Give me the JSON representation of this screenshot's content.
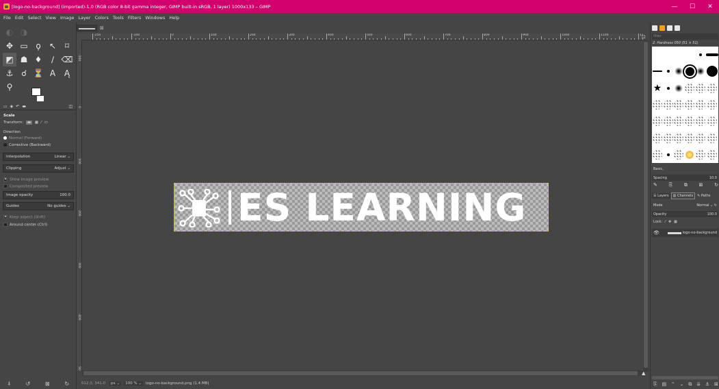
{
  "window": {
    "title": "[logo-no-background] (imported)-1.0 (RGB color 8-bit gamma integer, GIMP built-in sRGB, 1 layer) 1000x133 – GIMP",
    "min": "—",
    "max": "☐",
    "close": "✕"
  },
  "menubar": {
    "items": [
      "File",
      "Edit",
      "Select",
      "View",
      "Image",
      "Layer",
      "Colors",
      "Tools",
      "Filters",
      "Windows",
      "Help"
    ]
  },
  "toolbox": {
    "tool_options": {
      "title": "Scale",
      "transform_label": "Transform:",
      "direction_label": "Direction",
      "direction_options": [
        "Normal (Forward)",
        "Corrective (Backward)"
      ],
      "interpolation": {
        "label": "Interpolation",
        "value": "Linear"
      },
      "clipping": {
        "label": "Clipping",
        "value": "Adjust"
      },
      "show_preview": "Show image preview",
      "composited_preview": "Composited preview",
      "image_opacity": {
        "label": "Image opacity",
        "value": "100.0"
      },
      "guides": {
        "label": "Guides",
        "value": "No guides"
      },
      "keep_aspect": "Keep aspect (Shift)",
      "around_center": "Around center (Ctrl)"
    }
  },
  "rulers": {
    "h_labels": [
      "-250",
      "-100",
      "0",
      "100",
      "200",
      "300",
      "400",
      "500",
      "600",
      "700",
      "800",
      "900",
      "1000",
      "1100",
      "1200"
    ],
    "v_labels": [
      "-100",
      "0",
      "100",
      "200",
      "300",
      "400",
      "500"
    ]
  },
  "canvas": {
    "logo_text": "ES LEARNING"
  },
  "status": {
    "coords": "612.0, 341.0",
    "unit": "px",
    "zoom": "100 %",
    "file": "logo-no-background.png (1.4 MB)"
  },
  "dock": {
    "filter_placeholder": "filter",
    "brush_name": "2. Hardness 050 (51 × 51)",
    "preset_label": "Basic,",
    "spacing": {
      "label": "Spacing",
      "value": "10.0"
    },
    "tabs": [
      "Layers",
      "Channels",
      "Paths"
    ],
    "mode": {
      "label": "Mode",
      "value": "Normal"
    },
    "opacity": {
      "label": "Opacity",
      "value": "100.0"
    },
    "lock_label": "Lock:",
    "layer_name": "logo-no-background"
  },
  "colors": {
    "titlebar": "#d1006c",
    "bg": "#454545",
    "selection": "#d4c24a"
  }
}
